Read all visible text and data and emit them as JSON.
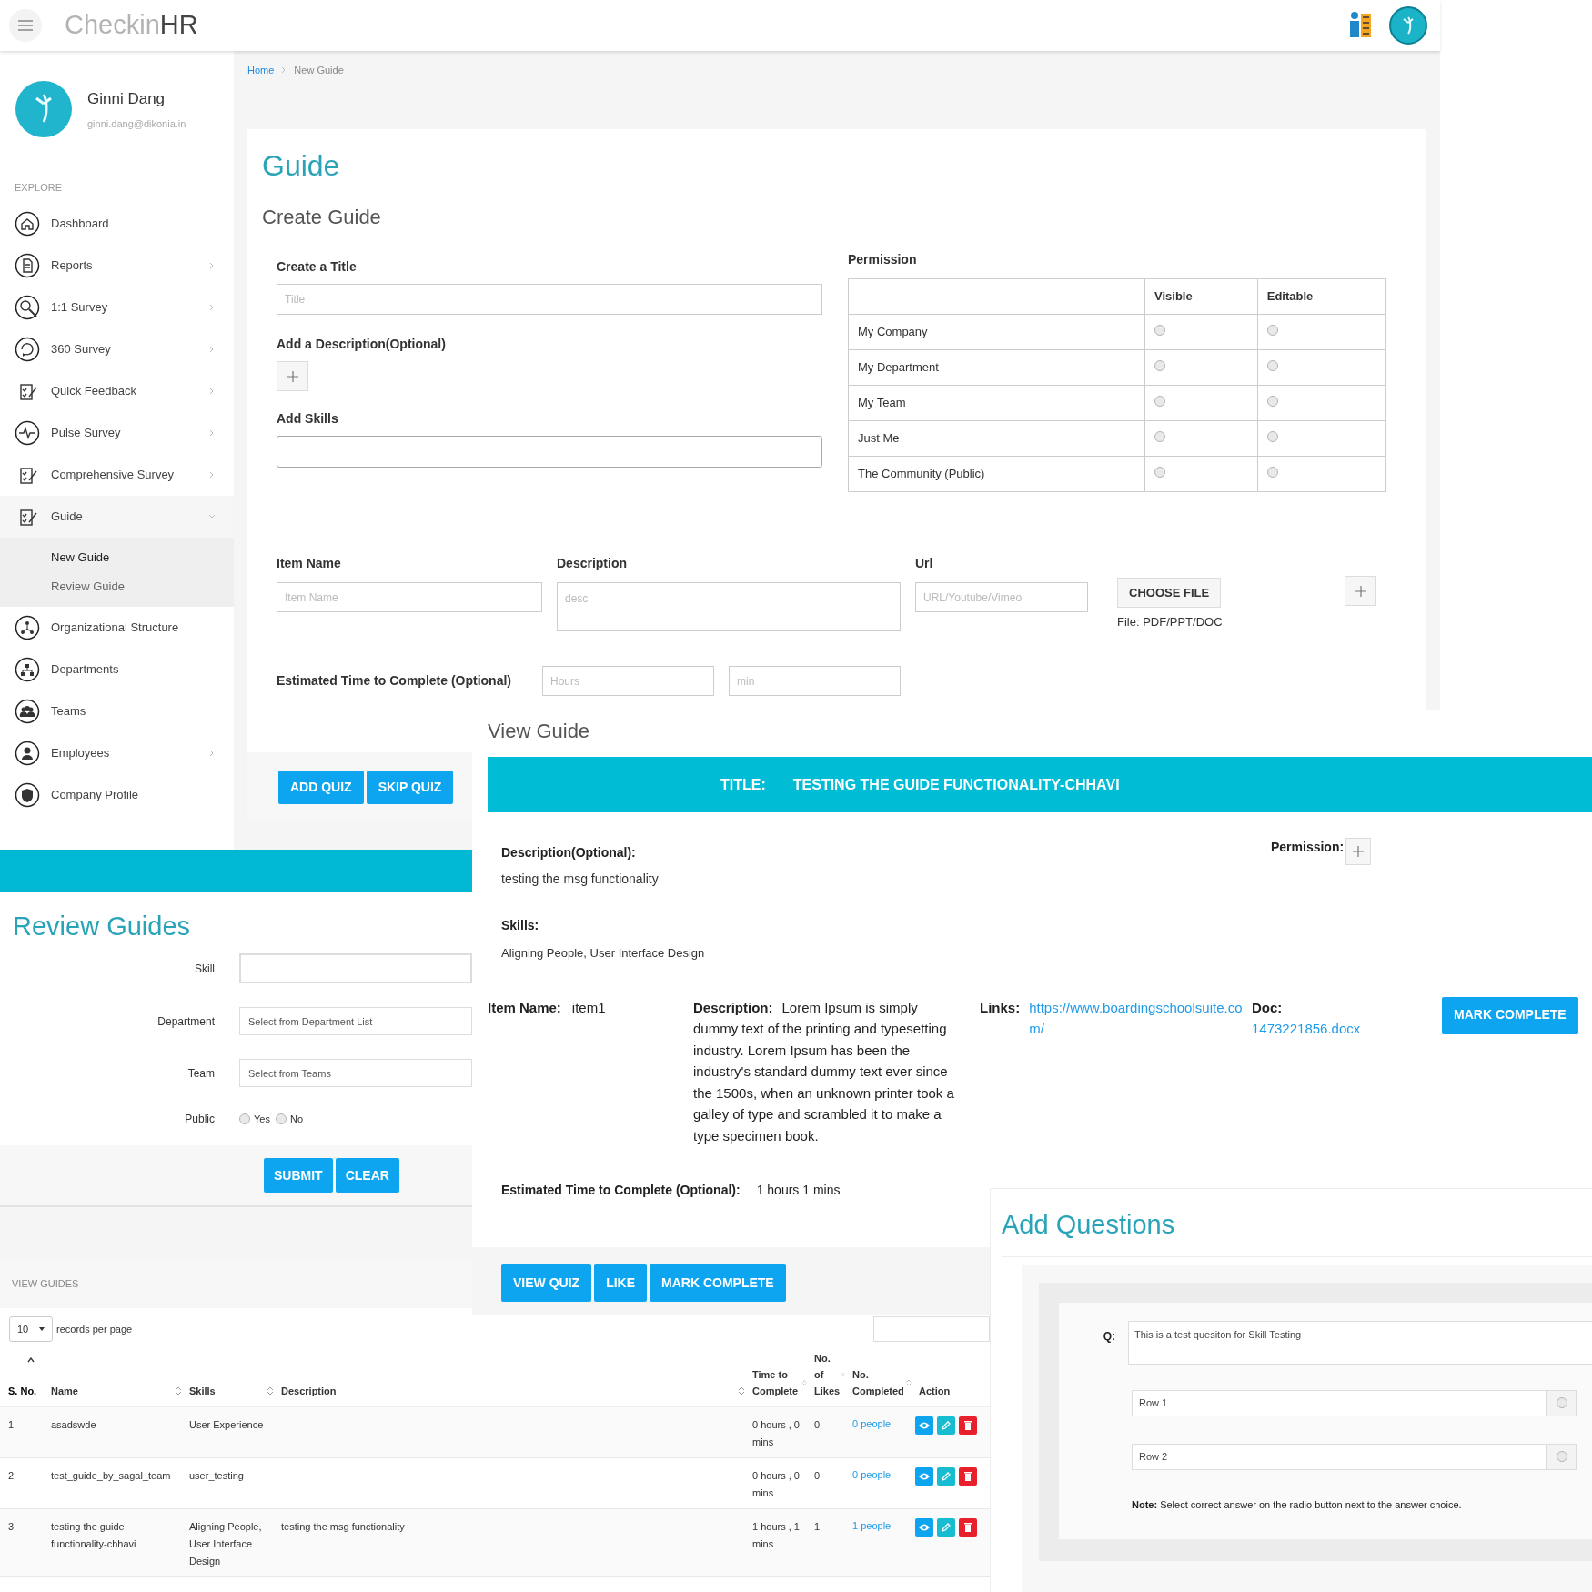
{
  "header": {
    "logo_light": "Checkin",
    "logo_bold": "HR"
  },
  "user": {
    "name": "Ginni Dang",
    "email": "ginni.dang@dikonia.in"
  },
  "sidebar": {
    "section": "EXPLORE",
    "items": [
      {
        "label": "Dashboard",
        "kind": "link"
      },
      {
        "label": "Reports",
        "kind": "submenu",
        "expanded": false
      },
      {
        "label": "1:1 Survey",
        "kind": "submenu",
        "expanded": false
      },
      {
        "label": "360 Survey",
        "kind": "submenu",
        "expanded": false
      },
      {
        "label": "Quick Feedback",
        "kind": "submenu",
        "expanded": false
      },
      {
        "label": "Pulse Survey",
        "kind": "submenu",
        "expanded": false
      },
      {
        "label": "Comprehensive Survey",
        "kind": "submenu",
        "expanded": false
      },
      {
        "label": "Guide",
        "kind": "submenu",
        "expanded": true,
        "children": [
          {
            "label": "New Guide",
            "selected": true
          },
          {
            "label": "Review Guide",
            "selected": false
          }
        ]
      },
      {
        "label": "Organizational Structure",
        "kind": "link"
      },
      {
        "label": "Departments",
        "kind": "link"
      },
      {
        "label": "Teams",
        "kind": "link"
      },
      {
        "label": "Employees",
        "kind": "submenu",
        "expanded": false
      },
      {
        "label": "Company Profile",
        "kind": "link"
      }
    ]
  },
  "breadcrumb": [
    {
      "label": "Home",
      "current": false
    },
    {
      "label": "New Guide",
      "current": true
    }
  ],
  "create_guide": {
    "page_title": "Guide",
    "subtitle": "Create Guide",
    "title_label": "Create a Title",
    "title_placeholder": "Title",
    "description_label": "Add a Description(Optional)",
    "skills_label": "Add Skills",
    "permission": {
      "label": "Permission",
      "columns": [
        "Visible",
        "Editable"
      ],
      "rows": [
        {
          "label": "My Company",
          "visible": false,
          "editable": false
        },
        {
          "label": "My Department",
          "visible": false,
          "editable": false
        },
        {
          "label": "My Team",
          "visible": false,
          "editable": false
        },
        {
          "label": "Just Me",
          "visible": false,
          "editable": false
        },
        {
          "label": "The Community (Public)",
          "visible": false,
          "editable": false
        }
      ]
    },
    "item": {
      "name_label": "Item Name",
      "name_placeholder": "Item Name",
      "description_label": "Description",
      "description_placeholder": "desc",
      "url_label": "Url",
      "url_placeholder": "URL/Youtube/Vimeo",
      "file_button": "CHOOSE FILE",
      "file_hint": "File: PDF/PPT/DOC"
    },
    "time": {
      "label": "Estimated Time to Complete (Optional)",
      "hours_placeholder": "Hours",
      "min_placeholder": "min"
    },
    "buttons": [
      "ADD QUIZ",
      "SKIP QUIZ"
    ]
  },
  "view_guide": {
    "heading": "View Guide",
    "title_label": "TITLE:",
    "title": "TESTING THE GUIDE FUNCTIONALITY-CHHAVI",
    "description_label": "Description(Optional):",
    "description": "testing the msg functionality",
    "permission_label": "Permission:",
    "skills_label": "Skills:",
    "skills": "Aligning People, User Interface Design",
    "item": {
      "name_label": "Item Name:",
      "name": "item1",
      "description_label": "Description:",
      "description": "Lorem Ipsum is simply dummy text of the printing and typesetting industry. Lorem Ipsum has been the industry's standard dummy text ever since the 1500s, when an unknown printer took a galley of type and scrambled it to make a type specimen book.",
      "links_label": "Links:",
      "link": "https://www.boardingschoolsuite.com/",
      "doc_label": "Doc:",
      "doc": "1473221856.docx",
      "button": "MARK COMPLETE"
    },
    "time_label": "Estimated Time to Complete (Optional):",
    "time": "1 hours 1 mins",
    "buttons": [
      "VIEW QUIZ",
      "LIKE",
      "MARK COMPLETE"
    ]
  },
  "review_guides": {
    "title": "Review Guides",
    "fields": [
      {
        "label": "Skill",
        "kind": "text"
      },
      {
        "label": "Department",
        "kind": "select",
        "placeholder": "Select from Department List"
      },
      {
        "label": "Team",
        "kind": "select",
        "placeholder": "Select from Teams"
      },
      {
        "label": "Public",
        "kind": "radio",
        "options": [
          {
            "label": "Yes",
            "selected": false
          },
          {
            "label": "No",
            "selected": false
          }
        ]
      }
    ],
    "buttons": [
      "SUBMIT",
      "CLEAR"
    ]
  },
  "view_guides": {
    "section": "VIEW GUIDES",
    "page_size": "10",
    "page_size_label": "records per page",
    "columns": [
      {
        "label": "S. No.",
        "sortable": true,
        "sorted": true
      },
      {
        "label": "Name",
        "sortable": true,
        "sorted": false
      },
      {
        "label": "Skills",
        "sortable": true,
        "sorted": false
      },
      {
        "label": "Description",
        "sortable": true,
        "sorted": false
      },
      {
        "label": "Time to Complete",
        "sortable": true,
        "sorted": false
      },
      {
        "label": "No. of Likes",
        "sortable": true,
        "sorted": false
      },
      {
        "label": "No. Completed",
        "sortable": true,
        "sorted": false
      },
      {
        "label": "Action",
        "sortable": false,
        "sorted": false
      }
    ],
    "rows": [
      {
        "sno": "1",
        "name": "asadswde",
        "skills": "User Experience",
        "time": "0 hours , 0 mins",
        "likes": "0",
        "completed": "0 people"
      },
      {
        "sno": "2",
        "name": "test_guide_by_sagal_team",
        "skills": "user_testing",
        "time": "0 hours , 0 mins",
        "likes": "0",
        "completed": "0 people"
      },
      {
        "sno": "3",
        "name": "testing the guide functionality-chhavi",
        "skills": "Aligning People, User Interface Design",
        "description": "testing the msg functionality",
        "time": "1 hours , 1 mins",
        "likes": "1",
        "completed": "1 people"
      }
    ]
  },
  "add_questions": {
    "title": "Add Questions",
    "question_label": "Q:",
    "question": "This is a test quesiton for Skill Testing",
    "answers": [
      {
        "value": "Row 1",
        "selected": false
      },
      {
        "value": "Row 2",
        "selected": false
      }
    ],
    "note": "**Note:** Select correct answer on the radio button next to the answer choice."
  }
}
